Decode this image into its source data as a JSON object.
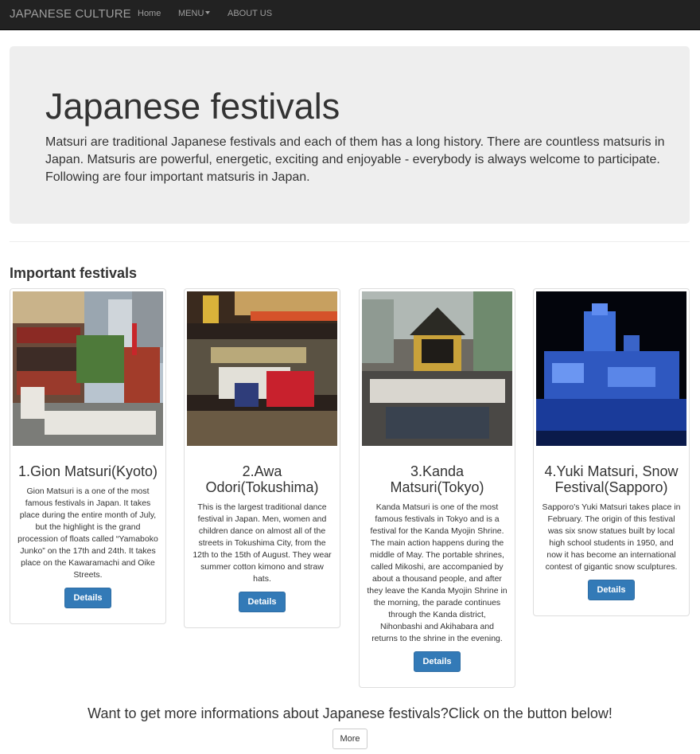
{
  "navbar": {
    "brand": "JAPANESE CULTURE",
    "links": [
      {
        "label": "Home"
      },
      {
        "label": "MENU"
      },
      {
        "label": "ABOUT US"
      }
    ]
  },
  "jumbotron": {
    "title": "Japanese festivals",
    "text": "Matsuri are traditional Japanese festivals and each of them has a long history. There are countless matsuris in Japan. Matsuris are powerful, energetic, exciting and enjoyable - everybody is always welcome to participate. Following are four important matsuris in Japan."
  },
  "section": {
    "title": "Important festivals"
  },
  "festivals": [
    {
      "title": "1.Gion Matsuri(Kyoto)",
      "text": "Gion Matsuri is a one of the most famous festivals in Japan. It takes place during the entire month of July, but the highlight is the grand procession of floats called “Yamaboko Junko” on the 17th and 24th. It takes place on the Kawaramachi and Oike Streets.",
      "button": "Details"
    },
    {
      "title": "2.Awa Odori(Tokushima)",
      "text": "This is the largest traditional dance festival in Japan. Men, women and children dance on almost all of the streets in Tokushima City, from the 12th to the 15th of August. They wear summer cotton kimono and straw hats.",
      "button": "Details"
    },
    {
      "title": "3.Kanda Matsuri(Tokyo)",
      "text": "Kanda Matsuri is one of the most famous festivals in Tokyo and is a festival for the Kanda Myojin Shrine. The main action happens during the middle of May. The portable shrines, called Mikoshi, are accompanied by about a thousand people, and after they leave the Kanda Myojin Shrine in the morning, the parade continues through the Kanda district, Nihonbashi and Akihabara and returns to the shrine in the evening.",
      "button": "Details"
    },
    {
      "title": "4.Yuki Matsuri, Snow Festival(Sapporo)",
      "text": "Sapporo's Yuki Matsuri takes place in February. The origin of this festival was six snow statues built by local high school students in 1950, and now it has become an international contest of gigantic snow sculptures.",
      "button": "Details"
    }
  ],
  "footer": {
    "text": "Want to get more informations about Japanese festivals?Click on the button below!",
    "button": "More"
  },
  "colors": {
    "navbar": "#222222",
    "jumbotron": "#eeeeee",
    "primary_button": "#337ab7"
  }
}
